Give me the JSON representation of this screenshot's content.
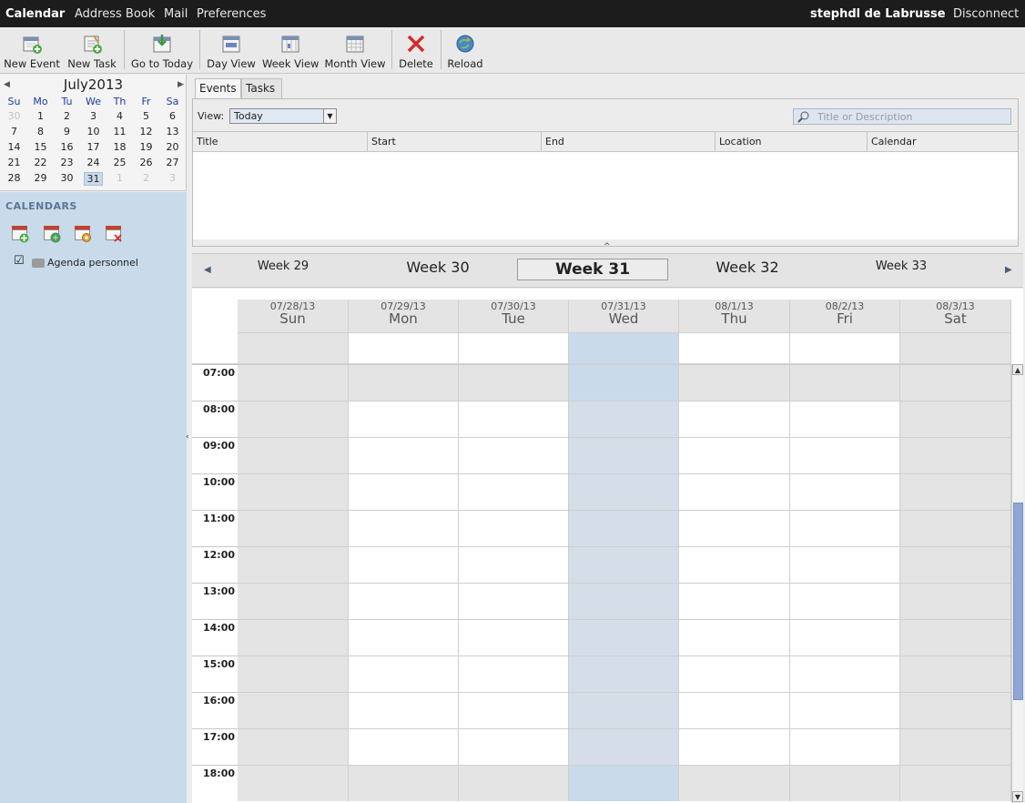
{
  "topbar": {
    "items": [
      "Calendar",
      "Address Book",
      "Mail",
      "Preferences"
    ],
    "user": "stephdl de Labrusse",
    "disconnect": "Disconnect"
  },
  "toolbar": {
    "new_event": "New Event",
    "new_task": "New Task",
    "go_to_today": "Go to Today",
    "day_view": "Day View",
    "week_view": "Week View",
    "month_view": "Month View",
    "delete": "Delete",
    "reload": "Reload"
  },
  "minical": {
    "month": "July",
    "year": "2013",
    "weekdays": [
      "Su",
      "Mo",
      "Tu",
      "We",
      "Th",
      "Fr",
      "Sa"
    ],
    "weeks": [
      [
        "30",
        "1",
        "2",
        "3",
        "4",
        "5",
        "6"
      ],
      [
        "7",
        "8",
        "9",
        "10",
        "11",
        "12",
        "13"
      ],
      [
        "14",
        "15",
        "16",
        "17",
        "18",
        "19",
        "20"
      ],
      [
        "21",
        "22",
        "23",
        "24",
        "25",
        "26",
        "27"
      ],
      [
        "28",
        "29",
        "30",
        "31",
        "1",
        "2",
        "3"
      ]
    ],
    "today": "31"
  },
  "sidebar": {
    "heading": "CALENDARS",
    "calendar_name": "Agenda personnel",
    "checked": true
  },
  "tabs": {
    "events": "Events",
    "tasks": "Tasks"
  },
  "filter": {
    "view_label": "View:",
    "view_value": "Today",
    "search_placeholder": "Title or Description"
  },
  "columns": [
    "Title",
    "Start",
    "End",
    "Location",
    "Calendar"
  ],
  "weeknav": {
    "weeks": [
      "Week 29",
      "Week 30",
      "Week 31",
      "Week 32",
      "Week 33"
    ],
    "current": "Week 31"
  },
  "days": [
    {
      "date": "07/28/13",
      "name": "Sun"
    },
    {
      "date": "07/29/13",
      "name": "Mon"
    },
    {
      "date": "07/30/13",
      "name": "Tue"
    },
    {
      "date": "07/31/13",
      "name": "Wed"
    },
    {
      "date": "08/1/13",
      "name": "Thu"
    },
    {
      "date": "08/2/13",
      "name": "Fri"
    },
    {
      "date": "08/3/13",
      "name": "Sat"
    }
  ],
  "hours": [
    "07:00",
    "08:00",
    "09:00",
    "10:00",
    "11:00",
    "12:00",
    "13:00",
    "14:00",
    "15:00",
    "16:00",
    "17:00",
    "18:00"
  ],
  "colors": {
    "weekend_bg": "#e4e4e4",
    "today_bg": "#d5dde9",
    "today_offhours_bg": "#c9dbea",
    "offhours_bg": "#e4e4e4",
    "workhours_bg": "#ffffff",
    "sidebar_bg": "#c9dbea"
  }
}
